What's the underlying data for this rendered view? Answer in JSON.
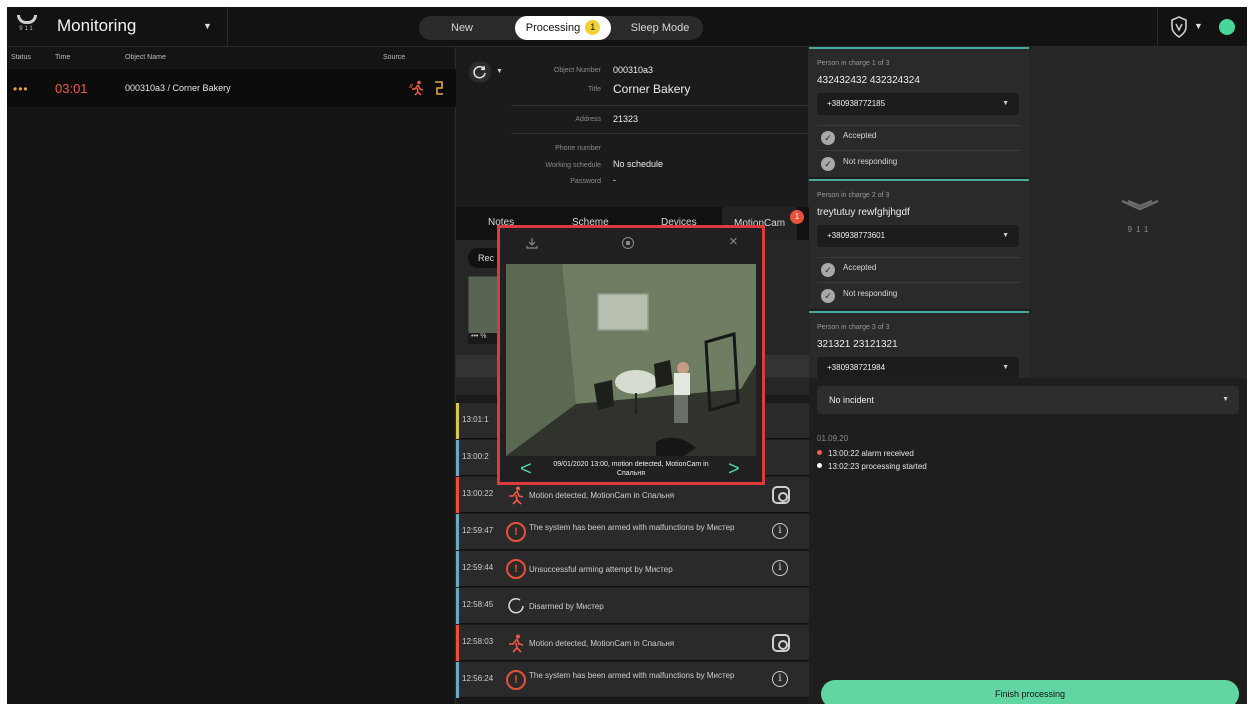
{
  "app": {
    "logo_text": "911",
    "title": "Monitoring"
  },
  "topbar": {
    "tabs": [
      {
        "label": "New"
      },
      {
        "label": "Processing",
        "badge": "1"
      },
      {
        "label": "Sleep Mode"
      }
    ],
    "status_color": "#47d79b"
  },
  "left": {
    "columns": [
      "Status",
      "Time",
      "Object Name",
      "Source"
    ],
    "rows": [
      {
        "status": "•••",
        "time": "03:01",
        "object_name": "000310a3 / Corner Bakery",
        "source_icons": [
          "motion-icon",
          "door-sensor-icon"
        ]
      }
    ]
  },
  "object": {
    "number_label": "Object Number",
    "number": "000310a3",
    "title_label": "Title",
    "title": "Corner Bakery",
    "address_label": "Address",
    "address": "21323",
    "phone_label": "Phone number",
    "phone": "",
    "schedule_label": "Working schedule",
    "schedule": "No schedule",
    "password_label": "Password",
    "password": "-"
  },
  "tabs": [
    {
      "label": "Notes"
    },
    {
      "label": "Scheme"
    },
    {
      "label": "Devices"
    },
    {
      "label": "MotionCam",
      "badge": "1"
    }
  ],
  "motioncam": {
    "record_button": "Rec",
    "thumb_label": "••• %"
  },
  "modal": {
    "caption": "09/01/2020 13:00, motion detected, MotionCam in Спальня",
    "prev": "<",
    "next": ">",
    "close": "×"
  },
  "events": [
    {
      "time": "13:01:1",
      "text": "",
      "bar": "#d9c64a"
    },
    {
      "time": "13:00:2",
      "text": "",
      "bar": "#6da8c4"
    },
    {
      "time": "13:00:22",
      "text": "Motion detected, MotionCam in Спальня",
      "bar": "#e9503a",
      "icon": "motion-icon",
      "action": "camera-icon"
    },
    {
      "time": "12:59:47",
      "text": "The system has been armed with malfunctions by Мистер",
      "bar": "#6da8c4",
      "icon": "alert-icon",
      "action": "info-icon"
    },
    {
      "time": "12:59:44",
      "text": "Unsuccessful arming attempt by Мистер",
      "bar": "#6da8c4",
      "icon": "alert-icon",
      "action": "info-icon"
    },
    {
      "time": "12:58:45",
      "text": "Disarmed by Мистер",
      "bar": "#6da8c4",
      "icon": "disarm-icon",
      "action": ""
    },
    {
      "time": "12:58:03",
      "text": "Motion detected, MotionCam in Спальня",
      "bar": "#e9503a",
      "icon": "motion-icon",
      "action": "camera-icon"
    },
    {
      "time": "12:56:24",
      "text": "The system has been armed with malfunctions by Мистер",
      "bar": "#6da8c4",
      "icon": "alert-icon",
      "action": "info-icon"
    }
  ],
  "persons": [
    {
      "header": "Person in charge 1 of 3",
      "name": "432432432 432324324",
      "phone": "+380938772185",
      "statuses": [
        "Accepted",
        "Not responding"
      ]
    },
    {
      "header": "Person in charge 2 of 3",
      "name": "treytutuy rewfghjhgdf",
      "phone": "+380938773601",
      "statuses": [
        "Accepted",
        "Not responding"
      ]
    },
    {
      "header": "Person in charge 3 of 3",
      "name": "321321 23121321",
      "phone": "+380938721984",
      "statuses": []
    }
  ],
  "brand": {
    "num": "911"
  },
  "incident": {
    "select": "No incident",
    "date": "01.09.20",
    "log": [
      {
        "text": "13:00:22 alarm received",
        "color": "#ee5b46"
      },
      {
        "text": "13:02:23 processing started",
        "color": "#ffffff"
      }
    ],
    "finish": "Finish processing"
  }
}
